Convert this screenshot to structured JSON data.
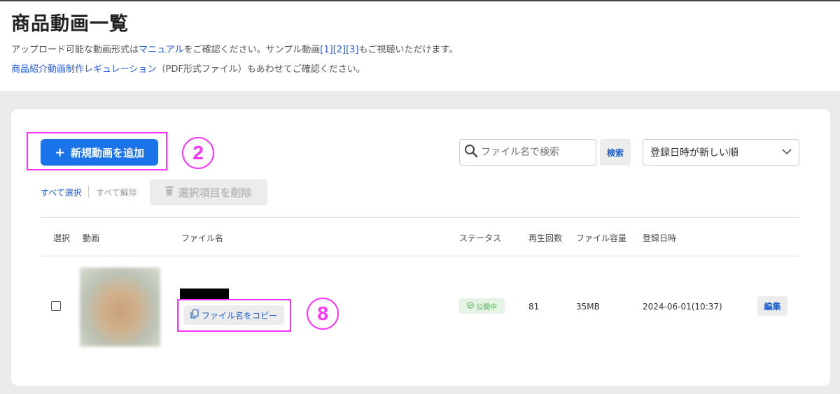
{
  "header": {
    "title": "商品動画一覧",
    "desc1": {
      "prefix": "アップロード可能な動画形式は",
      "manual_link": "マニュアル",
      "middle": "をご確認ください。サンプル動画",
      "sample1": "[1]",
      "sample2": "[2]",
      "sample3": "[3]",
      "suffix": "もご視聴いただけます。"
    },
    "desc2": {
      "regulation_link": "商品紹介動画制作レギュレーション",
      "suffix": "（PDF形式ファイル）もあわせてご確認ください。"
    }
  },
  "toolbar": {
    "add_label": "新規動画を追加",
    "add_icon": "plus-icon",
    "search_placeholder": "ファイル名で検索",
    "search_button": "検索",
    "sort_selected": "登録日時が新しい順",
    "select_all": "すべて選択",
    "deselect_all": "すべて解除",
    "delete_label": "選択項目を削除",
    "delete_icon": "trash-icon"
  },
  "annotations": {
    "two": "2",
    "eight": "8"
  },
  "table": {
    "headers": {
      "select": "選択",
      "video": "動画",
      "filename": "ファイル名",
      "status": "ステータス",
      "plays": "再生回数",
      "size": "ファイル容量",
      "date": "登録日時"
    },
    "rows": [
      {
        "copy_label": "ファイル名をコピー",
        "status": "公開中",
        "plays": "81",
        "size": "35MB",
        "date": "2024-06-01(10:37)",
        "edit": "編集"
      }
    ]
  },
  "colors": {
    "primary": "#1a73e8",
    "link": "#2b5fd9",
    "highlight": "#ff33ff",
    "status_bg": "#e6f4e6",
    "status_text": "#4caf50",
    "page_bg": "#ebebeb"
  }
}
